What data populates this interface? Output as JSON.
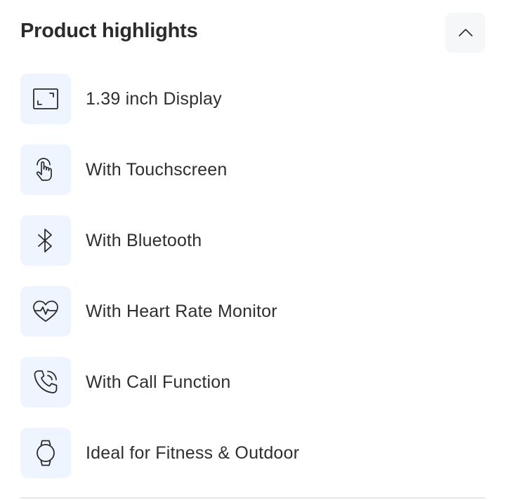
{
  "section": {
    "title": "Product highlights",
    "collapse_icon": "chevron-up-icon"
  },
  "highlights": [
    {
      "label": "1.39 inch Display",
      "icon": "display-size-icon"
    },
    {
      "label": "With Touchscreen",
      "icon": "touch-hand-icon"
    },
    {
      "label": "With Bluetooth",
      "icon": "bluetooth-icon"
    },
    {
      "label": "With Heart Rate Monitor",
      "icon": "heart-rate-icon"
    },
    {
      "label": "With Call Function",
      "icon": "phone-call-icon"
    },
    {
      "label": "Ideal for Fitness & Outdoor",
      "icon": "watch-icon"
    }
  ],
  "colors": {
    "icon_background": "#eef5fe",
    "button_background": "#f6f7f8",
    "text": "#2f2f2f",
    "divider": "#e6e6e6"
  }
}
